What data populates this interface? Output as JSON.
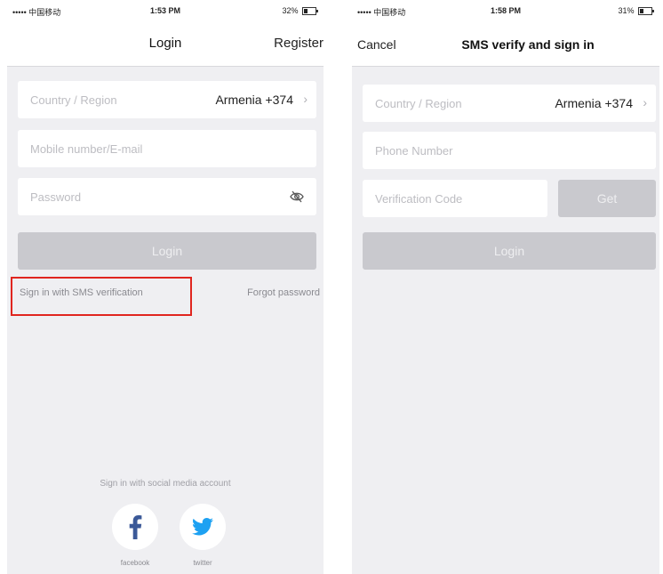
{
  "screen1": {
    "status": {
      "carrier": "••••• 中国移动",
      "time": "1:53 PM",
      "battery": "32%"
    },
    "nav": {
      "title": "Login",
      "register": "Register"
    },
    "country_label": "Country / Region",
    "country_value": "Armenia +374",
    "mobile_placeholder": "Mobile number/E-mail",
    "password_placeholder": "Password",
    "login_button": "Login",
    "sms_link": "Sign in with SMS verification",
    "forgot_link": "Forgot password",
    "social_caption": "Sign in with social media account",
    "facebook_label": "facebook",
    "twitter_label": "twitter",
    "colors": {
      "highlight": "#e0251f",
      "twitter": "#1da1f2",
      "facebook": "#3b5998"
    }
  },
  "screen2": {
    "status": {
      "carrier": "••••• 中国移动",
      "time": "1:58 PM",
      "battery": "31%"
    },
    "nav": {
      "cancel": "Cancel",
      "title": "SMS verify and sign in"
    },
    "country_label": "Country / Region",
    "country_value": "Armenia +374",
    "phone_placeholder": "Phone Number",
    "code_placeholder": "Verification Code",
    "get_button": "Get",
    "login_button": "Login"
  }
}
